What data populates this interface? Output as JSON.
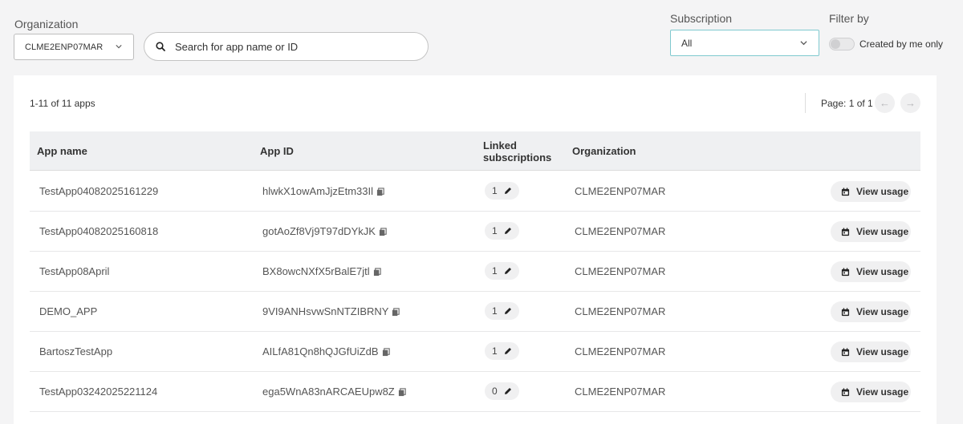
{
  "filters": {
    "organization_label": "Organization",
    "organization_value": "CLME2ENP07MAR",
    "search_placeholder": "Search for app name or ID",
    "subscription_label": "Subscription",
    "subscription_value": "All",
    "filter_label": "Filter by",
    "created_by_me_label": "Created by me only",
    "created_by_me_on": false
  },
  "listing": {
    "count_text": "1-11 of 11 apps",
    "page_text": "Page: 1 of 1"
  },
  "table": {
    "headers": {
      "app_name": "App name",
      "app_id": "App ID",
      "linked_line1": "Linked",
      "linked_line2": "subscriptions",
      "organization": "Organization"
    },
    "rows": [
      {
        "name": "TestApp04082025161229",
        "id": "hlwkX1owAmJjzEtm33Il",
        "linked": "1",
        "org": "CLME2ENP07MAR",
        "action": "View usage"
      },
      {
        "name": "TestApp04082025160818",
        "id": "gotAoZf8Vj9T97dDYkJK",
        "linked": "1",
        "org": "CLME2ENP07MAR",
        "action": "View usage"
      },
      {
        "name": "TestApp08April",
        "id": "BX8owcNXfX5rBalE7jtl",
        "linked": "1",
        "org": "CLME2ENP07MAR",
        "action": "View usage"
      },
      {
        "name": "DEMO_APP",
        "id": "9VI9ANHsvwSnNTZIBRNY",
        "linked": "1",
        "org": "CLME2ENP07MAR",
        "action": "View usage"
      },
      {
        "name": "BartoszTestApp",
        "id": "AILfA81Qn8hQJGfUiZdB",
        "linked": "1",
        "org": "CLME2ENP07MAR",
        "action": "View usage"
      },
      {
        "name": "TestApp03242025221124",
        "id": "ega5WnA83nARCAEUpw8Z",
        "linked": "0",
        "org": "CLME2ENP07MAR",
        "action": "View usage"
      }
    ]
  },
  "colors": {
    "accent_border": "#7fc9cf",
    "header_bg": "#eff0f2",
    "chip_bg": "#f0f0f1"
  },
  "icons": [
    "search-icon",
    "chevron-down-icon",
    "copy-icon",
    "pencil-icon",
    "calendar-icon",
    "arrow-left-icon",
    "arrow-right-icon"
  ]
}
